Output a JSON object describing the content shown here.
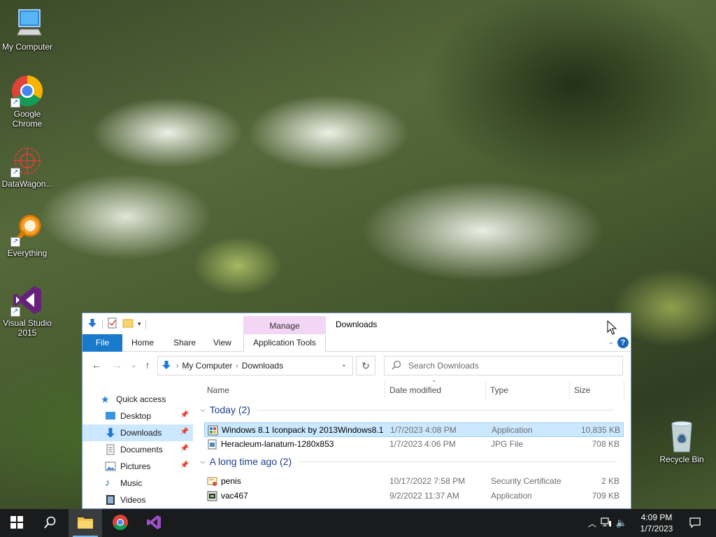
{
  "desktop": {
    "icons": [
      {
        "label": "My Computer"
      },
      {
        "label": "Google Chrome"
      },
      {
        "label": "DataWagon..."
      },
      {
        "label": "Everything"
      },
      {
        "label": "Visual Studio 2015"
      }
    ],
    "recycle_bin": "Recycle Bin"
  },
  "explorer": {
    "title": "Downloads",
    "contextual_tab": "Manage",
    "ribbon_tabs": {
      "file": "File",
      "home": "Home",
      "share": "Share",
      "view": "View",
      "app_tools": "Application Tools"
    },
    "address": {
      "root": "My Computer",
      "current": "Downloads"
    },
    "search_placeholder": "Search Downloads",
    "nav": {
      "quick_access": "Quick access",
      "items": [
        {
          "label": "Desktop"
        },
        {
          "label": "Downloads"
        },
        {
          "label": "Documents"
        },
        {
          "label": "Pictures"
        },
        {
          "label": "Music"
        },
        {
          "label": "Videos"
        }
      ]
    },
    "columns": {
      "name": "Name",
      "date": "Date modified",
      "type": "Type",
      "size": "Size"
    },
    "groups": [
      {
        "label": "Today (2)",
        "files": [
          {
            "name": "Windows 8.1 Iconpack by 2013Windows8.1",
            "date": "1/7/2023 4:08 PM",
            "type": "Application",
            "size": "10,835 KB"
          },
          {
            "name": "Heracleum-lanatum-1280x853",
            "date": "1/7/2023 4:06 PM",
            "type": "JPG File",
            "size": "708 KB"
          }
        ]
      },
      {
        "label": "A long time ago (2)",
        "files": [
          {
            "name": "penis",
            "date": "10/17/2022 7:58 PM",
            "type": "Security Certificate",
            "size": "2 KB"
          },
          {
            "name": "vac467",
            "date": "9/2/2022 11:37 AM",
            "type": "Application",
            "size": "709 KB"
          }
        ]
      }
    ]
  },
  "taskbar": {
    "time": "4:09 PM",
    "date": "1/7/2023"
  },
  "colors": {
    "accent": "#1979ca",
    "selection": "#cce8ff",
    "manage_tab": "#f3d5f6",
    "taskbar": "#1a1b1c"
  }
}
